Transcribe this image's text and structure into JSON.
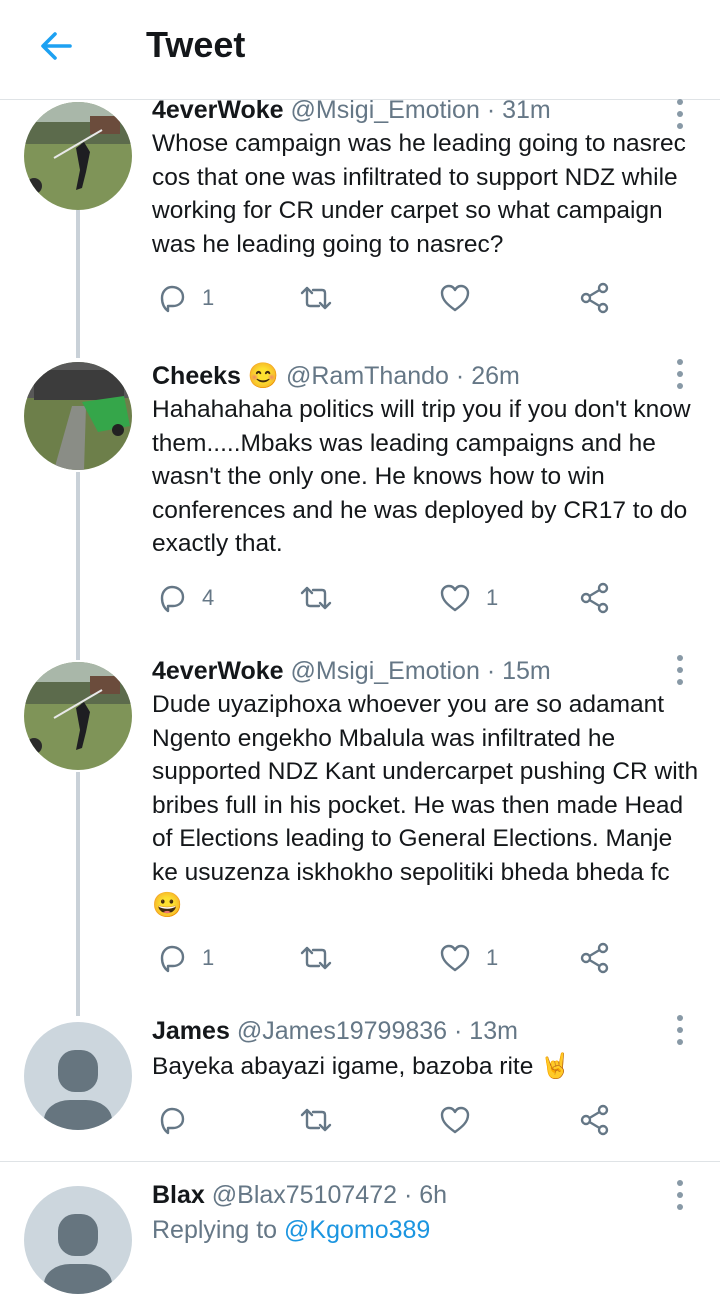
{
  "header": {
    "title": "Tweet"
  },
  "colors": {
    "accent": "#1da1f2",
    "muted": "#657786",
    "line": "#c9d1d8"
  },
  "tweets": [
    {
      "name": "4everWoke",
      "handle": "@Msigi_Emotion",
      "time": "31m",
      "text": "Whose campaign was he leading going to nasrec cos that one was infiltrated to support NDZ while working for CR under carpet so what campaign was he leading going to nasrec?",
      "replies": "1",
      "retweets": "",
      "likes": ""
    },
    {
      "name": "Cheeks",
      "emoji": "😊",
      "handle": "@RamThando",
      "time": "26m",
      "text": "Hahahahaha politics will trip you if you don't know them.....Mbaks was leading campaigns and he wasn't the only one. He knows how to win conferences and he was deployed by CR17 to do exactly that.",
      "replies": "4",
      "retweets": "",
      "likes": "1"
    },
    {
      "name": "4everWoke",
      "handle": "@Msigi_Emotion",
      "time": "15m",
      "text": "Dude uyaziphoxa whoever you are so adamant Ngento engekho Mbalula was infiltrated he supported NDZ Kant undercarpet pushing CR with bribes full in his pocket. He was then made Head of Elections leading to General Elections. Manje ke usuzenza iskhokho sepolitiki bheda bheda fc😀",
      "replies": "1",
      "retweets": "",
      "likes": "1"
    },
    {
      "name": "James",
      "handle": "@James19799836",
      "time": "13m",
      "text": "Bayeka abayazi igame, bazoba rite 🤘",
      "replies": "",
      "retweets": "",
      "likes": ""
    },
    {
      "name": "Blax",
      "handle": "@Blax75107472",
      "time": "6h",
      "replying_prefix": "Replying to ",
      "replying_to": "@Kgomo389"
    }
  ]
}
